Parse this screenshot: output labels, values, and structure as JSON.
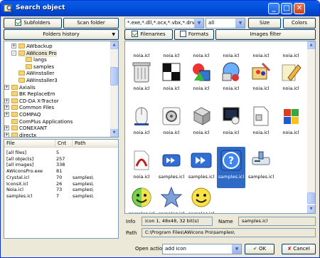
{
  "window": {
    "title": "Search object"
  },
  "left": {
    "subfolders_label": "Subfolders",
    "subfolders_checked": true,
    "scan_folder": "Scan folder",
    "history_label": "Folders history",
    "tree": [
      {
        "label": "AWbackup",
        "indent": 2,
        "expander": "+"
      },
      {
        "label": "AWicons Pro",
        "indent": 2,
        "expander": "-",
        "selected": true
      },
      {
        "label": "langs",
        "indent": 3,
        "expander": ""
      },
      {
        "label": "samples",
        "indent": 3,
        "expander": ""
      },
      {
        "label": "AWinstaller",
        "indent": 2,
        "expander": ""
      },
      {
        "label": "AWinstaller3",
        "indent": 2,
        "expander": ""
      },
      {
        "label": "Axialis",
        "indent": 1,
        "expander": "+"
      },
      {
        "label": "BK ReplaceEm",
        "indent": 1,
        "expander": ""
      },
      {
        "label": "CD-DA X-Tractor",
        "indent": 1,
        "expander": "+"
      },
      {
        "label": "Common Files",
        "indent": 1,
        "expander": "+"
      },
      {
        "label": "COMPAQ",
        "indent": 1,
        "expander": "+"
      },
      {
        "label": "ComPlus Applications",
        "indent": 1,
        "expander": ""
      },
      {
        "label": "CONEXANT",
        "indent": 1,
        "expander": "+"
      },
      {
        "label": "directx",
        "indent": 1,
        "expander": "+"
      }
    ],
    "table": {
      "columns": [
        "File",
        "Cnt",
        "Path"
      ],
      "rows": [
        [
          "[all files]",
          "5",
          ""
        ],
        [
          "[all objects]",
          "257",
          ""
        ],
        [
          "[all images]",
          "338",
          ""
        ],
        [
          "AWiconsPro.exe",
          "81",
          ""
        ],
        [
          "Crystal.icl",
          "70",
          "samples\\"
        ],
        [
          "IconsX.icl",
          "26",
          "samples\\"
        ],
        [
          "Noia.icl",
          "73",
          "samples\\"
        ],
        [
          "samples.icl",
          "7",
          "samples\\"
        ]
      ]
    }
  },
  "top": {
    "mask": "*.exe,*.dll,*.ocx,*.vbx,*.drv,*",
    "filter": "all",
    "size_btn": "Size",
    "colors_btn": "Colors",
    "filenames_label": "Filenames",
    "filenames_checked": true,
    "formats_label": "Formats",
    "formats_checked": false,
    "images_filter": "Images filter"
  },
  "grid": {
    "rows": [
      [
        "noia.icl",
        "noia.icl",
        "noia.icl",
        "noia.icl",
        "noia.icl",
        "noia.icl"
      ],
      [
        "noia.icl",
        "noia.icl",
        "noia.icl",
        "noia.icl",
        "noia.icl",
        "noia.icl"
      ],
      [
        "noia.icl",
        "noia.icl",
        "noia.icl",
        "noia.icl",
        "noia.icl",
        "noia.icl"
      ],
      [
        "noia.icl",
        "samples.icl",
        "samples.icl",
        "samples.icl",
        "samples.icl",
        ""
      ],
      [
        "samples.icl",
        "samples.icl",
        "samples.icl",
        "",
        "",
        ""
      ]
    ],
    "icons": [
      [
        "noia-top-icon",
        "noia-top-icon",
        "noia-top-icon",
        "noia-top-icon",
        "noia-top-icon",
        "noia-top-icon"
      ],
      [
        "trash-icon",
        "checkers-icon",
        "shapes-icon",
        "network-icon",
        "colors-icon",
        "pencil-icon"
      ],
      [
        "mouse-icon",
        "gear-disc-icon",
        "box-icon",
        "monitor-icon",
        "doc-icon",
        "windows-icon"
      ],
      [
        "pdf-icon",
        "forward-small-icon",
        "forward-large-icon",
        "help-icon",
        "drive-icon",
        ""
      ],
      [
        "smile-half-icon",
        "star-icon",
        "smile-icon",
        "",
        "",
        ""
      ]
    ],
    "colors": {
      "blue": "#2f6fd6",
      "accent": "#316ac5"
    }
  },
  "info": {
    "info_label": "Info",
    "info_value": "icon 1, 48x48, 32 bit(s)",
    "name_label": "Name",
    "name_value": "samples.icl",
    "path_label": "Path",
    "path_value": "C:\\Program Files\\AWicons Pro\\samples\\"
  },
  "bottom": {
    "open_action_label": "Open action",
    "open_action_value": "add icon",
    "ok": "OK",
    "cancel": "Cancel"
  }
}
